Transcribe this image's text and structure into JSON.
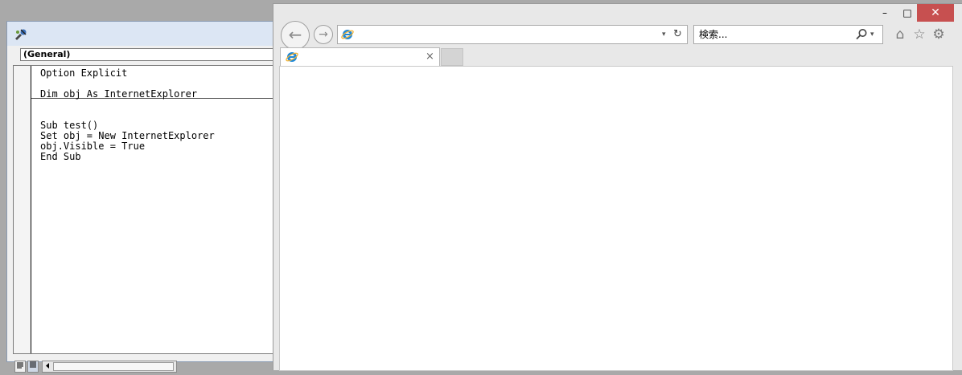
{
  "vba_editor": {
    "procedure_combo_value": "(General)",
    "code_lines": [
      "Option Explicit",
      "",
      "Dim obj As InternetExplorer",
      "",
      "",
      "Sub test()",
      "Set obj = New InternetExplorer",
      "obj.Visible = True",
      "End Sub"
    ],
    "icons": {
      "title": "vba-editor-icon",
      "procedure_view": "procedure-view-icon",
      "full_module_view": "full-module-view-icon",
      "scroll_left": "scroll-left-arrow-icon"
    }
  },
  "ie": {
    "address_value": "",
    "search_placeholder": "検索...",
    "window_buttons": {
      "minimize": "–",
      "maximize": "□",
      "close": "✕"
    },
    "nav": {
      "back": "←",
      "forward": "→",
      "refresh": "↻",
      "address_dropdown": "▾",
      "search_dropdown": "▾"
    },
    "toolbar": {
      "home": "⌂",
      "favorites": "☆",
      "tools": "⚙"
    },
    "tab": {
      "title": "",
      "close": "×"
    },
    "colors": {
      "close_button": "#c75050",
      "ie_logo": "#1e88d8",
      "ie_ring": "#f2b234"
    }
  }
}
